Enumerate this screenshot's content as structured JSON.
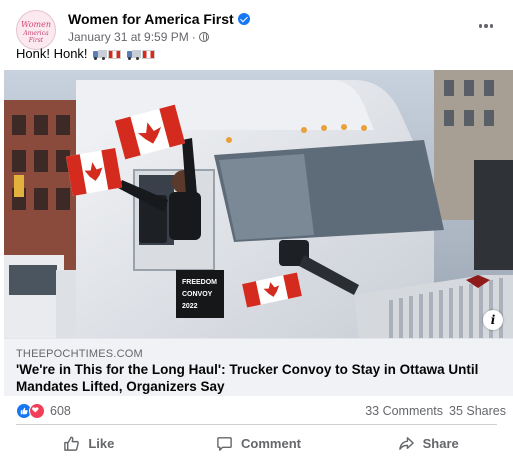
{
  "post": {
    "page_name": "Women for America First",
    "avatar_text_line1": "Women",
    "avatar_text_line2": "America First",
    "timestamp": "January 31 at 9:59 PM",
    "body_text": "Honk! Honk!",
    "link": {
      "domain": "THEEPOCHTIMES.COM",
      "headline": "'We're in This for the Long Haul': Trucker Convoy to Stay in Ottawa Until Mandates Lifted, Organizers Say"
    },
    "truck_lettering": [
      "FREEDOM",
      "CONVOY",
      "2022"
    ],
    "reactions": {
      "count": "608"
    },
    "comments": "33 Comments",
    "shares": "35 Shares",
    "actions": {
      "like": "Like",
      "comment": "Comment",
      "share": "Share"
    }
  },
  "colors": {
    "brand_blue": "#1877f2",
    "heart_red": "#f33e58",
    "secondary_text": "#65676b",
    "canada_red": "#d52b1e"
  },
  "icons": [
    "verified-badge-icon",
    "globe-icon",
    "more-options-icon",
    "info-icon",
    "like-reaction-icon",
    "love-reaction-icon",
    "thumbs-up-icon",
    "comment-icon",
    "share-icon"
  ]
}
